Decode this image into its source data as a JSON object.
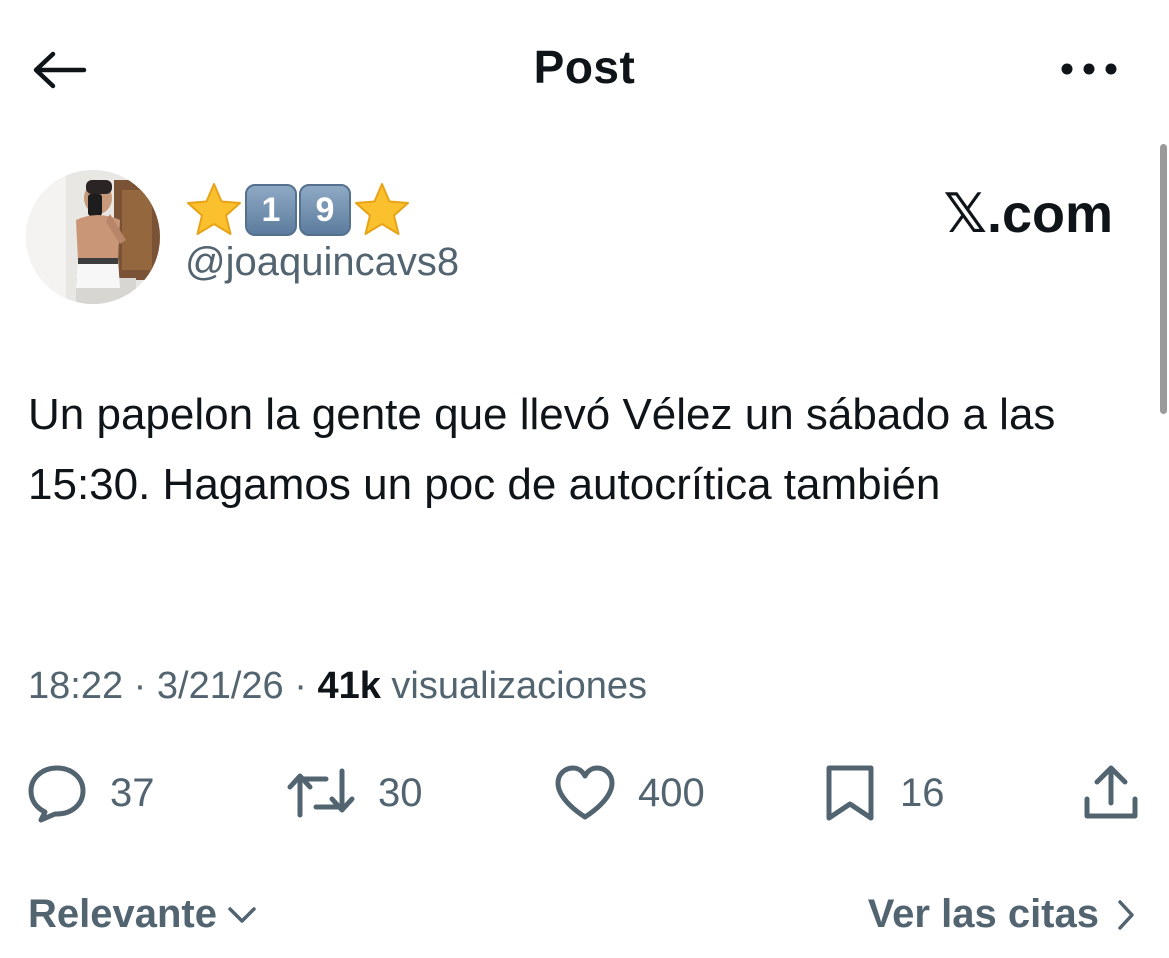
{
  "header": {
    "title": "Post",
    "back_icon": "arrow-left-icon",
    "more_icon": "more-horizontal-icon"
  },
  "author": {
    "display_name_emoji": [
      "⭐",
      "1",
      "9",
      "⭐"
    ],
    "handle": "@joaquincavs8",
    "avatar": "profile-photo"
  },
  "watermark": "𝕏.com",
  "post": {
    "text": "Un papelon la gente que llevó Vélez un sábado a las 15:30. Hagamos un poc de autocrítica también",
    "time": "18:22",
    "separator": "·",
    "date": "3/21/26",
    "views_count": "41k",
    "views_label": "visualizaciones"
  },
  "actions": {
    "replies": "37",
    "reposts": "30",
    "likes": "400",
    "bookmarks": "16"
  },
  "footer": {
    "sort_label": "Relevante",
    "quotes_label": "Ver las citas"
  },
  "colors": {
    "text_primary": "#0f1419",
    "text_secondary": "#536471",
    "background": "#ffffff"
  }
}
